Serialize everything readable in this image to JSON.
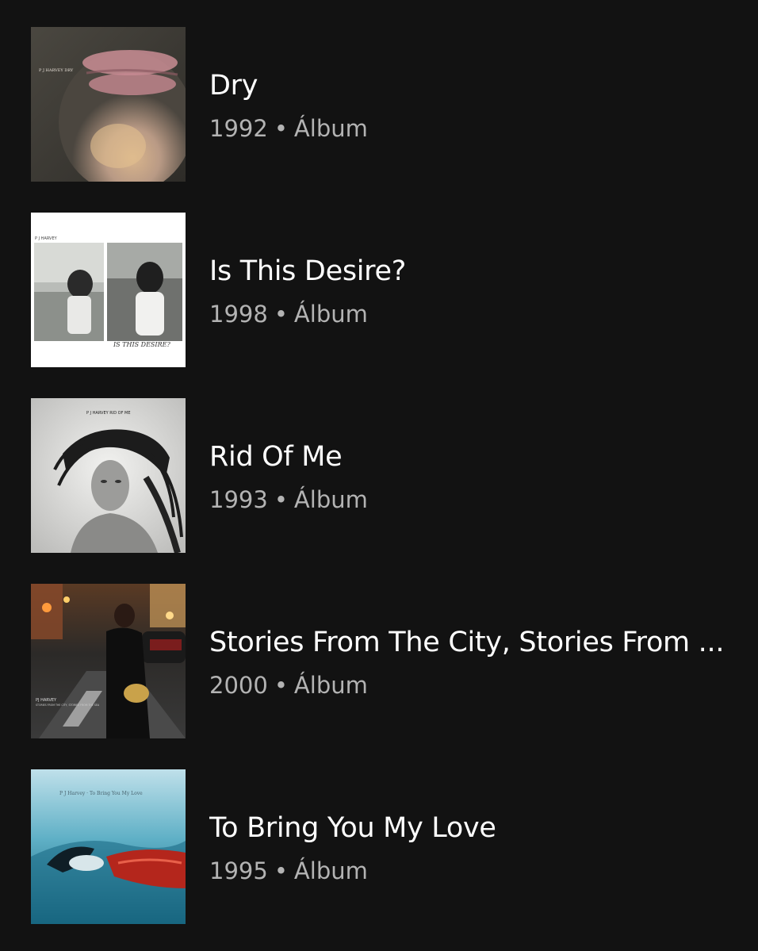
{
  "albums": [
    {
      "title": "Dry",
      "year": "1992",
      "separator": "•",
      "type": "Álbum",
      "cover_text": "P J HARVEY   DRY",
      "cover_icon": "album-cover-dry"
    },
    {
      "title": "Is This Desire?",
      "year": "1998",
      "separator": "•",
      "type": "Álbum",
      "cover_text": "P J HARVEY",
      "cover_text_2": "IS THIS DESIRE?",
      "cover_icon": "album-cover-is-this-desire"
    },
    {
      "title": "Rid Of Me",
      "year": "1993",
      "separator": "•",
      "type": "Álbum",
      "cover_text": "P J HARVEY   RID OF ME",
      "cover_icon": "album-cover-rid-of-me"
    },
    {
      "title": "Stories From The City, Stories From ...",
      "year": "2000",
      "separator": "•",
      "type": "Álbum",
      "cover_text": "PJ HARVEY",
      "cover_text_2": "STORIES FROM THE CITY, STORIES FROM THE SEA",
      "cover_icon": "album-cover-stories-from-the-city"
    },
    {
      "title": "To Bring You My Love",
      "year": "1995",
      "separator": "•",
      "type": "Álbum",
      "cover_text": "P J Harvey · To Bring You My Love",
      "cover_icon": "album-cover-to-bring-you-my-love"
    }
  ],
  "colors": {
    "background": "#121212",
    "title": "#ffffff",
    "meta": "#b3b3b3"
  }
}
